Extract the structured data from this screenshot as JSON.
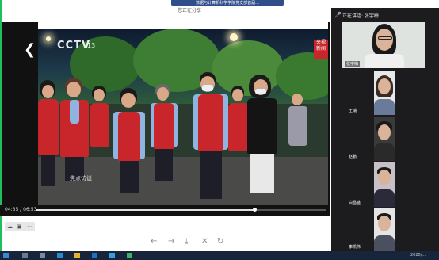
{
  "banner": {
    "notification": "数据与计算机科学学院党支部首届...",
    "share_hint": "您正在分享"
  },
  "video": {
    "channel_logo": "CCTV",
    "channel_number": "13",
    "station_logo": "央视 新闻",
    "program_logo": "焦点访谈"
  },
  "player": {
    "time": "04:35 / 06:53",
    "progress": 0.75
  },
  "toolbar": {
    "mini_icons": [
      "cloud-icon",
      "screen-icon",
      "more-icon"
    ],
    "tools": [
      "back-icon",
      "forward-icon",
      "download-icon",
      "close-icon",
      "refresh-icon"
    ]
  },
  "panel": {
    "speaking_label": "正在讲话: 张宇梅",
    "participants": [
      {
        "name": "张宇梅"
      },
      {
        "name": "王瑞"
      },
      {
        "name": "赵鹏"
      },
      {
        "name": "白昌盛"
      },
      {
        "name": "李凯伟"
      }
    ]
  },
  "taskbar": {
    "clock": "2020/..."
  },
  "colors": {
    "panel_bg": "#1c1c1e",
    "vest_red": "#c8262a",
    "taskbar": "#17243a"
  }
}
